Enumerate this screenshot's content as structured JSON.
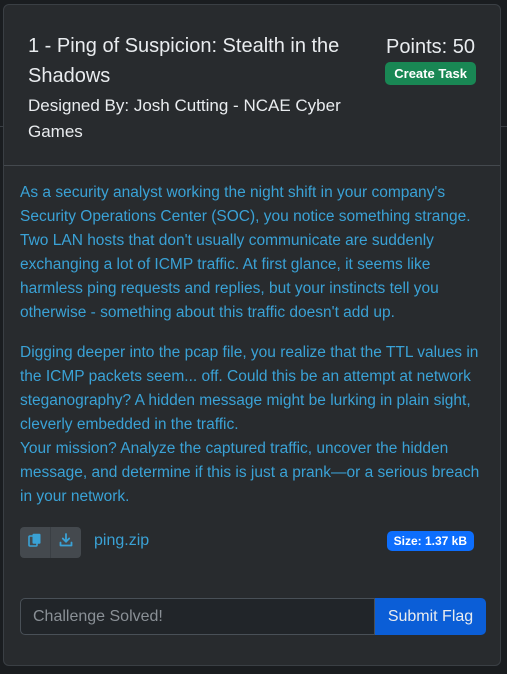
{
  "header": {
    "title": "1 - Ping of Suspicion: Stealth in the Shadows",
    "designer": "Designed By: Josh Cutting - NCAE Cyber Games",
    "points": "Points: 50",
    "create_task_label": "Create Task"
  },
  "description": {
    "paragraph_1": "As a security analyst working the night shift in your company's Security Operations Center (SOC), you notice something strange. Two LAN hosts that don't usually communicate are suddenly exchanging a lot of ICMP traffic. At first glance, it seems like harmless ping requests and replies, but your instincts tell you otherwise - something about this traffic doesn't add up.",
    "paragraph_2": "Digging deeper into the pcap file, you realize that the TTL values in the ICMP packets seem... off. Could this be an attempt at network steganography? A hidden message might be lurking in plain sight, cleverly embedded in the traffic.",
    "paragraph_3": "Your mission? Analyze the captured traffic, uncover the hidden message, and determine if this is just a prank—or a serious breach in your network."
  },
  "file": {
    "name": "ping.zip",
    "size": "Size: 1.37 kB",
    "icons": [
      "copy-icon",
      "download-icon"
    ]
  },
  "flag": {
    "placeholder": "Challenge Solved!",
    "submit_label": "Submit Flag"
  },
  "colors": {
    "accent_text": "#3aa2d6",
    "success": "#198754",
    "primary": "#0d6efd"
  }
}
